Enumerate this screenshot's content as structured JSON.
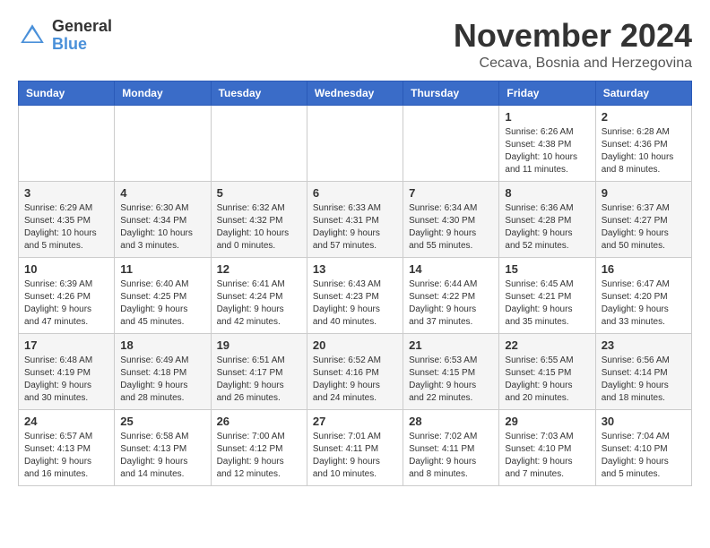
{
  "logo": {
    "general": "General",
    "blue": "Blue"
  },
  "title": "November 2024",
  "location": "Cecava, Bosnia and Herzegovina",
  "days_of_week": [
    "Sunday",
    "Monday",
    "Tuesday",
    "Wednesday",
    "Thursday",
    "Friday",
    "Saturday"
  ],
  "weeks": [
    [
      {
        "day": "",
        "info": ""
      },
      {
        "day": "",
        "info": ""
      },
      {
        "day": "",
        "info": ""
      },
      {
        "day": "",
        "info": ""
      },
      {
        "day": "",
        "info": ""
      },
      {
        "day": "1",
        "info": "Sunrise: 6:26 AM\nSunset: 4:38 PM\nDaylight: 10 hours and 11 minutes."
      },
      {
        "day": "2",
        "info": "Sunrise: 6:28 AM\nSunset: 4:36 PM\nDaylight: 10 hours and 8 minutes."
      }
    ],
    [
      {
        "day": "3",
        "info": "Sunrise: 6:29 AM\nSunset: 4:35 PM\nDaylight: 10 hours and 5 minutes."
      },
      {
        "day": "4",
        "info": "Sunrise: 6:30 AM\nSunset: 4:34 PM\nDaylight: 10 hours and 3 minutes."
      },
      {
        "day": "5",
        "info": "Sunrise: 6:32 AM\nSunset: 4:32 PM\nDaylight: 10 hours and 0 minutes."
      },
      {
        "day": "6",
        "info": "Sunrise: 6:33 AM\nSunset: 4:31 PM\nDaylight: 9 hours and 57 minutes."
      },
      {
        "day": "7",
        "info": "Sunrise: 6:34 AM\nSunset: 4:30 PM\nDaylight: 9 hours and 55 minutes."
      },
      {
        "day": "8",
        "info": "Sunrise: 6:36 AM\nSunset: 4:28 PM\nDaylight: 9 hours and 52 minutes."
      },
      {
        "day": "9",
        "info": "Sunrise: 6:37 AM\nSunset: 4:27 PM\nDaylight: 9 hours and 50 minutes."
      }
    ],
    [
      {
        "day": "10",
        "info": "Sunrise: 6:39 AM\nSunset: 4:26 PM\nDaylight: 9 hours and 47 minutes."
      },
      {
        "day": "11",
        "info": "Sunrise: 6:40 AM\nSunset: 4:25 PM\nDaylight: 9 hours and 45 minutes."
      },
      {
        "day": "12",
        "info": "Sunrise: 6:41 AM\nSunset: 4:24 PM\nDaylight: 9 hours and 42 minutes."
      },
      {
        "day": "13",
        "info": "Sunrise: 6:43 AM\nSunset: 4:23 PM\nDaylight: 9 hours and 40 minutes."
      },
      {
        "day": "14",
        "info": "Sunrise: 6:44 AM\nSunset: 4:22 PM\nDaylight: 9 hours and 37 minutes."
      },
      {
        "day": "15",
        "info": "Sunrise: 6:45 AM\nSunset: 4:21 PM\nDaylight: 9 hours and 35 minutes."
      },
      {
        "day": "16",
        "info": "Sunrise: 6:47 AM\nSunset: 4:20 PM\nDaylight: 9 hours and 33 minutes."
      }
    ],
    [
      {
        "day": "17",
        "info": "Sunrise: 6:48 AM\nSunset: 4:19 PM\nDaylight: 9 hours and 30 minutes."
      },
      {
        "day": "18",
        "info": "Sunrise: 6:49 AM\nSunset: 4:18 PM\nDaylight: 9 hours and 28 minutes."
      },
      {
        "day": "19",
        "info": "Sunrise: 6:51 AM\nSunset: 4:17 PM\nDaylight: 9 hours and 26 minutes."
      },
      {
        "day": "20",
        "info": "Sunrise: 6:52 AM\nSunset: 4:16 PM\nDaylight: 9 hours and 24 minutes."
      },
      {
        "day": "21",
        "info": "Sunrise: 6:53 AM\nSunset: 4:15 PM\nDaylight: 9 hours and 22 minutes."
      },
      {
        "day": "22",
        "info": "Sunrise: 6:55 AM\nSunset: 4:15 PM\nDaylight: 9 hours and 20 minutes."
      },
      {
        "day": "23",
        "info": "Sunrise: 6:56 AM\nSunset: 4:14 PM\nDaylight: 9 hours and 18 minutes."
      }
    ],
    [
      {
        "day": "24",
        "info": "Sunrise: 6:57 AM\nSunset: 4:13 PM\nDaylight: 9 hours and 16 minutes."
      },
      {
        "day": "25",
        "info": "Sunrise: 6:58 AM\nSunset: 4:13 PM\nDaylight: 9 hours and 14 minutes."
      },
      {
        "day": "26",
        "info": "Sunrise: 7:00 AM\nSunset: 4:12 PM\nDaylight: 9 hours and 12 minutes."
      },
      {
        "day": "27",
        "info": "Sunrise: 7:01 AM\nSunset: 4:11 PM\nDaylight: 9 hours and 10 minutes."
      },
      {
        "day": "28",
        "info": "Sunrise: 7:02 AM\nSunset: 4:11 PM\nDaylight: 9 hours and 8 minutes."
      },
      {
        "day": "29",
        "info": "Sunrise: 7:03 AM\nSunset: 4:10 PM\nDaylight: 9 hours and 7 minutes."
      },
      {
        "day": "30",
        "info": "Sunrise: 7:04 AM\nSunset: 4:10 PM\nDaylight: 9 hours and 5 minutes."
      }
    ]
  ]
}
